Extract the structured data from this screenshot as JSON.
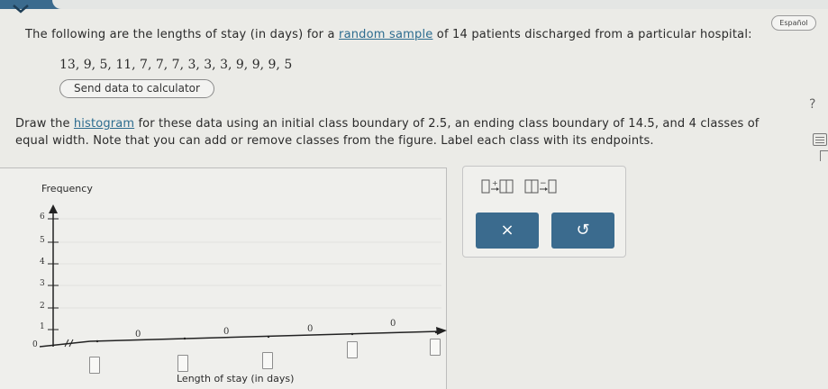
{
  "header": {
    "language_button": "Español"
  },
  "question": {
    "intro_prefix": "The following are the lengths of stay (in days) for a ",
    "intro_link": "random sample",
    "intro_suffix": " of 14 patients discharged from a particular hospital:",
    "data_values": "13, 9, 5, 11, 7, 7, 7, 3, 3, 3, 9, 9, 9, 5",
    "send_button": "Send data to calculator",
    "instr_prefix": "Draw the ",
    "instr_link": "histogram",
    "instr_suffix": " for these data using an initial class boundary of 2.5, an ending class boundary of 14.5, and 4 classes of equal width. Note that you can add or remove classes from the figure. Label each class with its endpoints."
  },
  "graph": {
    "y_axis_label": "Frequency",
    "x_axis_label": "Length of stay (in days)",
    "y_ticks": [
      "6",
      "5",
      "4",
      "3",
      "2",
      "1",
      "0"
    ],
    "class_frequencies": [
      "0",
      "0",
      "0",
      "0"
    ],
    "endpoint_inputs": [
      "",
      "",
      "",
      "",
      ""
    ]
  },
  "tools": {
    "add_class_icon": "add-class-icon",
    "remove_class_icon": "remove-class-icon",
    "clear_label": "×",
    "undo_label": "↺"
  },
  "colors": {
    "accent": "#3b6b8e",
    "link": "#2d6c8f"
  }
}
